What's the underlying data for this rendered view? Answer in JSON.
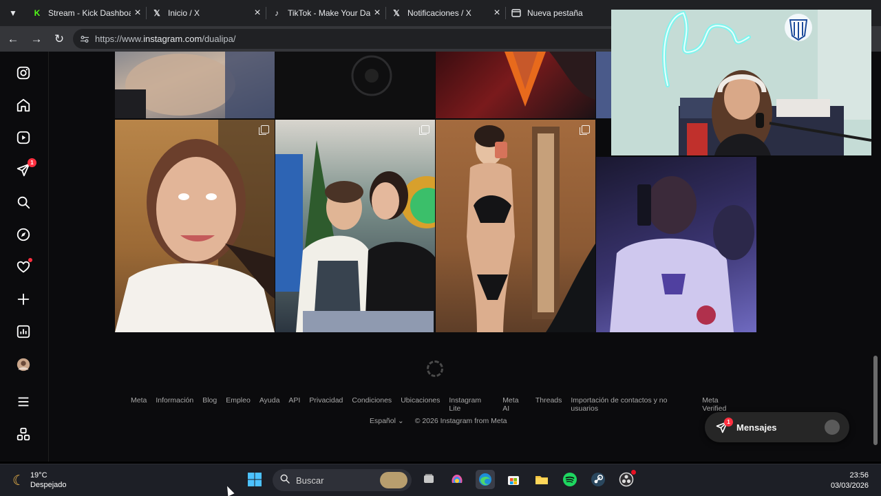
{
  "browser": {
    "tabs": [
      {
        "label": "Stream - Kick Dashboard",
        "icon": "kick-icon",
        "color": "#53fc18"
      },
      {
        "label": "Inicio / X",
        "icon": "x-icon",
        "color": "#ffffff"
      },
      {
        "label": "TikTok - Make Your Day",
        "icon": "tiktok-icon",
        "color": "#ffffff"
      },
      {
        "label": "Notificaciones / X",
        "icon": "x-icon",
        "color": "#ffffff"
      },
      {
        "label": "Nueva pestaña",
        "icon": "new-tab-icon",
        "color": "#ffffff"
      }
    ],
    "url_prefix": "https://www.",
    "url_host": "instagram.com",
    "url_path": "/dualipa/"
  },
  "instagram": {
    "sidebar_items": [
      "instagram-logo-icon",
      "home-icon",
      "reels-icon",
      "direct-icon",
      "search-icon",
      "explore-icon",
      "notifications-icon",
      "create-icon",
      "dashboard-icon",
      "profile-avatar",
      "more-icon",
      "threads-icon"
    ],
    "direct_badge": "1",
    "footer_links": [
      "Meta",
      "Información",
      "Blog",
      "Empleo",
      "Ayuda",
      "API",
      "Privacidad",
      "Condiciones",
      "Ubicaciones",
      "Instagram Lite",
      "Meta AI",
      "Threads",
      "Importación de contactos y no usuarios",
      "Meta Verified"
    ],
    "language": "Español",
    "copyright": "© 2026 Instagram from Meta",
    "messages_label": "Mensajes",
    "messages_badge": "1",
    "accent_badge_color": "#ff3040"
  },
  "taskbar": {
    "temperature": "19°C",
    "condition": "Despejado",
    "search_placeholder": "Buscar",
    "time": "23:56",
    "date": "03/03/2026"
  }
}
